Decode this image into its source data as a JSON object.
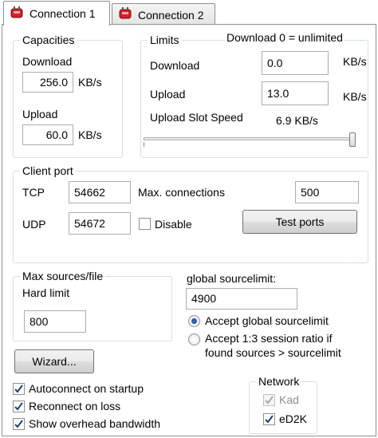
{
  "tabs": [
    {
      "label": "Connection 1",
      "icon": "red-plug-icon",
      "active": true
    },
    {
      "label": "Connection 2",
      "icon": "red-plug-icon",
      "active": false
    }
  ],
  "capacities": {
    "title": "Capacities",
    "download_label": "Download",
    "download_value": "256.0",
    "download_unit": "KB/s",
    "upload_label": "Upload",
    "upload_value": "60.0",
    "upload_unit": "KB/s"
  },
  "limits": {
    "title": "Limits",
    "note": "Download 0 = unlimited",
    "download_label": "Download",
    "download_value": "0.0",
    "download_unit": "KB/s",
    "upload_label": "Upload",
    "upload_value": "13.0",
    "upload_unit": "KB/s",
    "slot_speed_label": "Upload Slot Speed",
    "slot_speed_value": "6.9 KB/s",
    "slider_level": 1.0
  },
  "client_port": {
    "title": "Client port",
    "tcp_label": "TCP",
    "tcp_value": "54662",
    "max_conn_label": "Max. connections",
    "max_conn_value": "500",
    "udp_label": "UDP",
    "udp_value": "54672",
    "disable_label": "Disable",
    "disable_checked": false,
    "test_ports_label": "Test ports"
  },
  "max_sources": {
    "title": "Max sources/file",
    "hard_limit_label": "Hard limit",
    "hard_limit_value": "800"
  },
  "global_sourcelimit": {
    "label": "global sourcelimit:",
    "value": "4900",
    "option1_label": "Accept global sourcelimit",
    "option2_line1": "Accept 1:3 session ratio if",
    "option2_line2": "found sources > sourcelimit",
    "selected": "option1"
  },
  "wizard_label": "Wizard...",
  "options": [
    {
      "label": "Autoconnect on startup",
      "checked": true
    },
    {
      "label": "Reconnect on loss",
      "checked": true
    },
    {
      "label": "Show overhead bandwidth",
      "checked": true
    }
  ],
  "network": {
    "title": "Network",
    "kad_label": "Kad",
    "kad_checked": true,
    "kad_enabled": false,
    "ed2k_label": "eD2K",
    "ed2k_checked": true
  },
  "colors": {
    "accent": "#0b3f8a",
    "plug": "#d0202a",
    "group_border": "#d5dfe5"
  }
}
